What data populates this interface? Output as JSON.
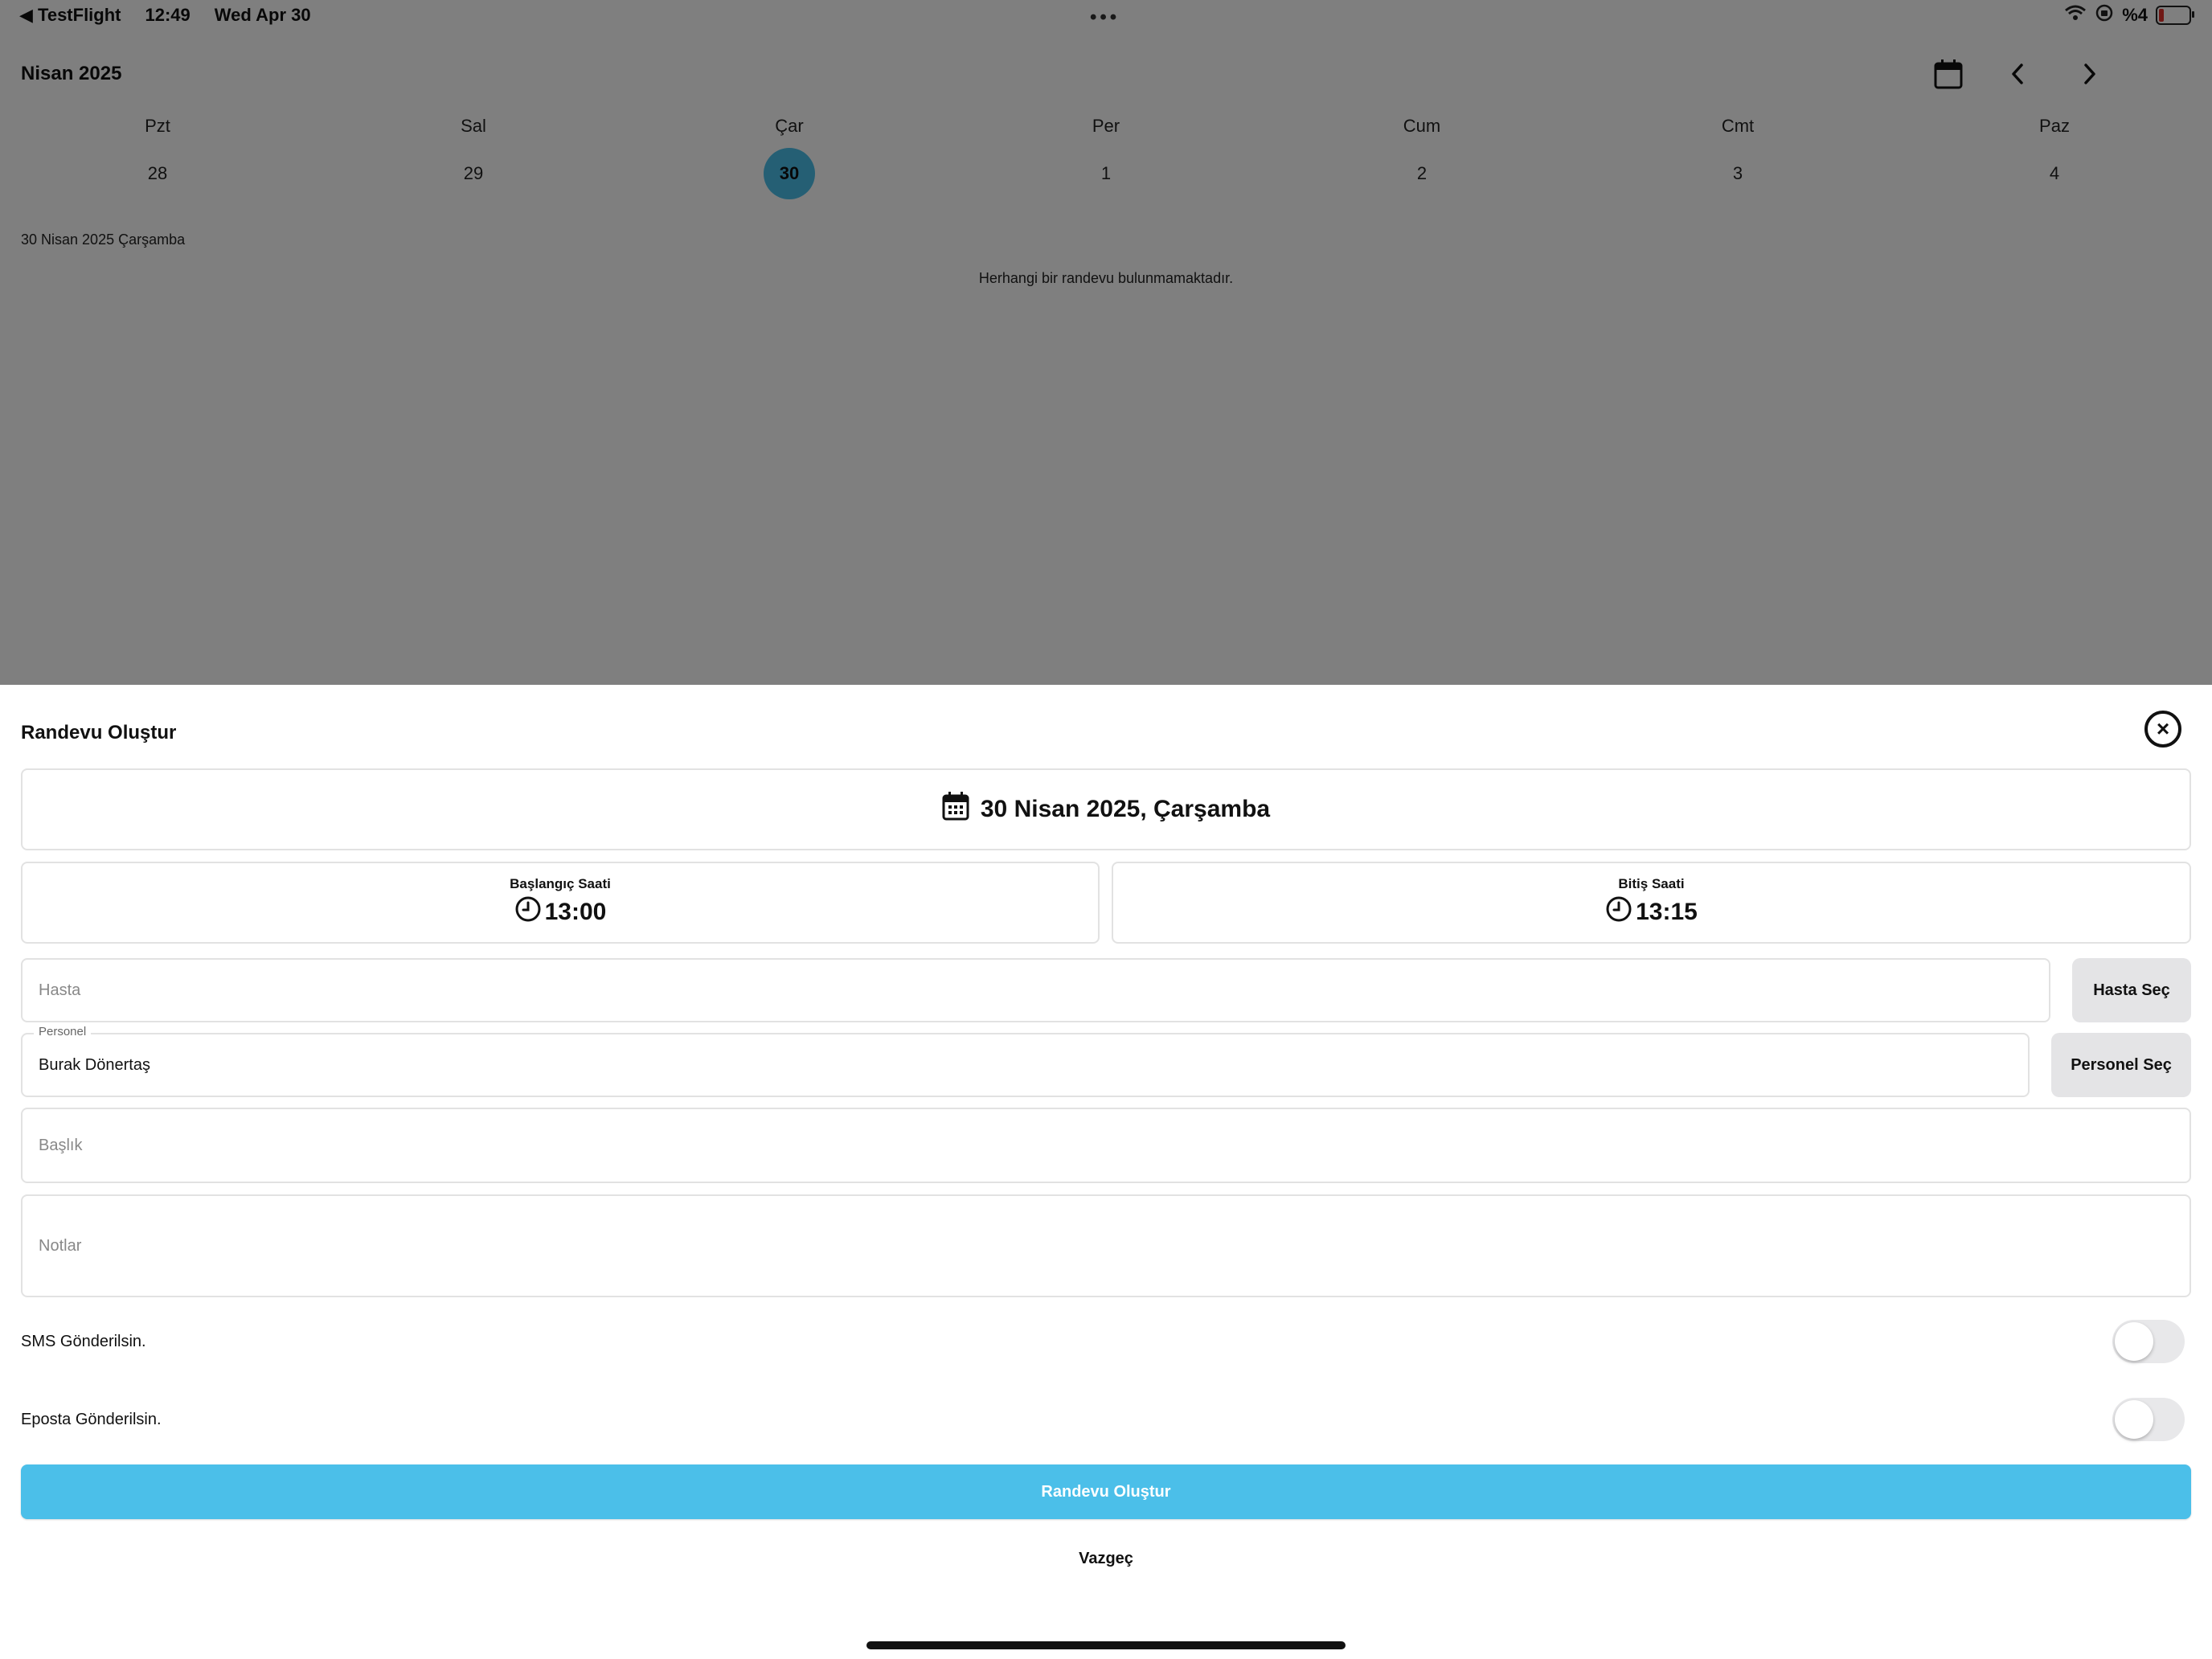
{
  "status_bar": {
    "back_app": "◀ TestFlight",
    "time": "12:49",
    "date": "Wed Apr 30",
    "multitask_dots": "•••",
    "battery": "%4"
  },
  "calendar": {
    "month_title": "Nisan 2025",
    "weekdays": [
      "Pzt",
      "Sal",
      "Çar",
      "Per",
      "Cum",
      "Cmt",
      "Paz"
    ],
    "days": [
      "28",
      "29",
      "30",
      "1",
      "2",
      "3",
      "4"
    ],
    "selected_day": "30",
    "selected_color": "#4bbfe9",
    "day_label": "30 Nisan 2025 Çarşamba",
    "empty_message": "Herhangi bir randevu bulunmamaktadır."
  },
  "sheet": {
    "title": "Randevu Oluştur",
    "date_display": "30 Nisan 2025, Çarşamba",
    "start": {
      "label": "Başlangıç Saati",
      "value": "13:00"
    },
    "end": {
      "label": "Bitiş Saati",
      "value": "13:15"
    },
    "patient": {
      "placeholder": "Hasta",
      "button": "Hasta Seç"
    },
    "staff": {
      "label": "Personel",
      "value": "Burak Dönertaş",
      "button": "Personel Seç"
    },
    "title_field": {
      "placeholder": "Başlık"
    },
    "notes_field": {
      "placeholder": "Notlar"
    },
    "sms_label": "SMS Gönderilsin.",
    "email_label": "Eposta Gönderilsin.",
    "sms_enabled": false,
    "email_enabled": false,
    "submit_label": "Randevu Oluştur",
    "cancel_label": "Vazgeç",
    "accent_color": "#4bbfe9"
  }
}
